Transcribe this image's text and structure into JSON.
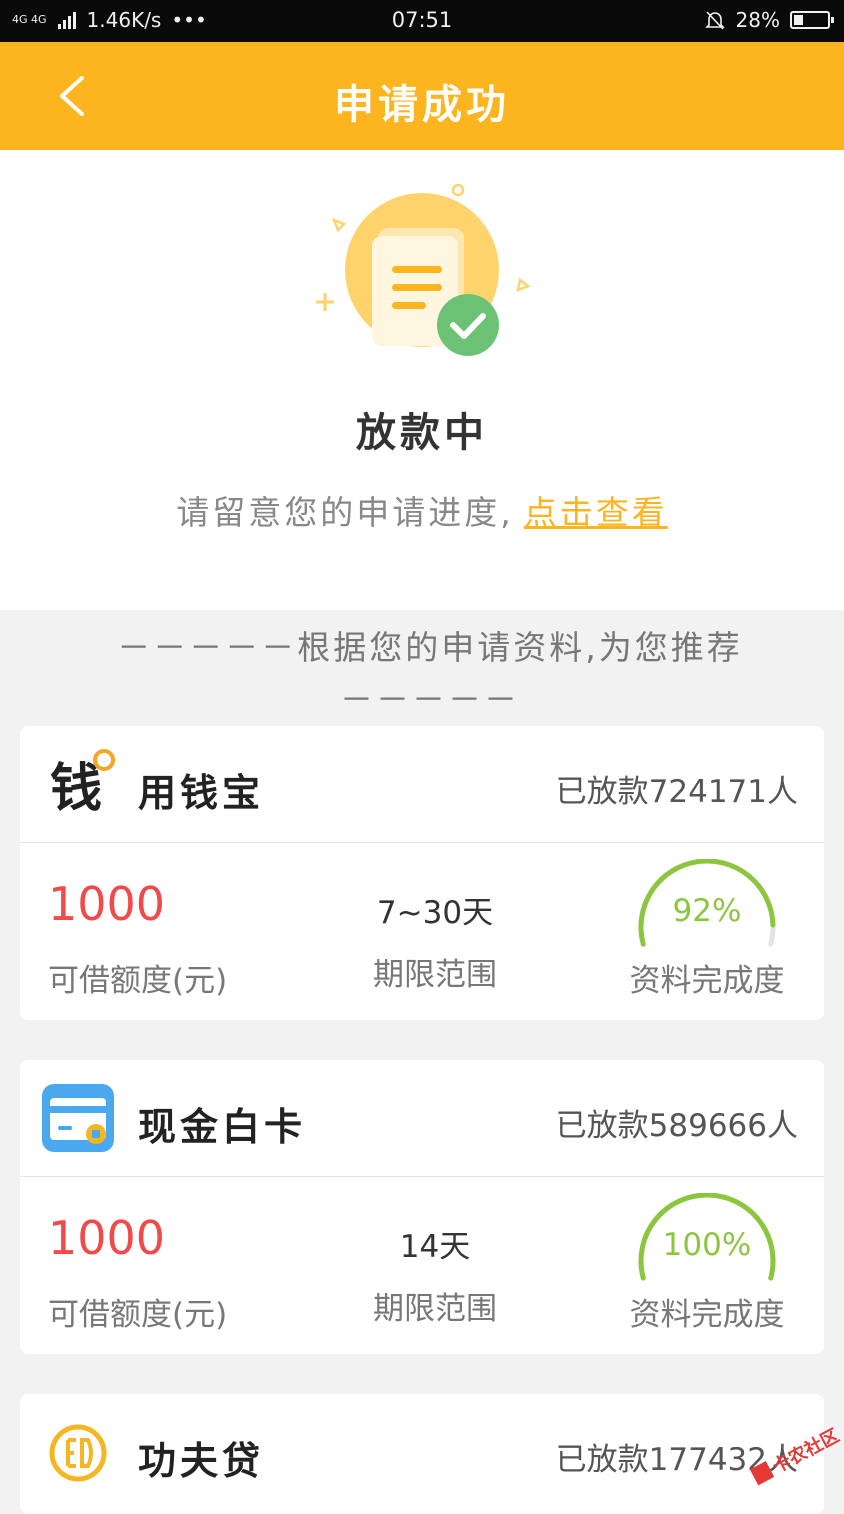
{
  "status_bar": {
    "network": "4G 4G",
    "speed": "1.46K/s",
    "dots": "•••",
    "time": "07:51",
    "battery": "28%",
    "battery_level": 0.28
  },
  "header": {
    "title": "申请成功"
  },
  "success": {
    "status_title": "放款中",
    "description": "请留意您的申请进度,",
    "link_text": "点击查看"
  },
  "recommend": {
    "heading_line1": "－－－－－根据您的申请资料,为您推荐",
    "heading_line2": "－－－－－"
  },
  "products": [
    {
      "name": "用钱宝",
      "logo_text": "钱",
      "count": "已放款724171人",
      "amount": "1000",
      "amount_label": "可借额度(元)",
      "term": "7~30天",
      "term_label": "期限范围",
      "completion": "92%",
      "completion_value": 0.92,
      "completion_label": "资料完成度"
    },
    {
      "name": "现金白卡",
      "count": "已放款589666人",
      "amount": "1000",
      "amount_label": "可借额度(元)",
      "term": "14天",
      "term_label": "期限范围",
      "completion": "100%",
      "completion_value": 1.0,
      "completion_label": "资料完成度"
    },
    {
      "name": "功夫贷",
      "count": "已放款177432人"
    }
  ],
  "watermark": {
    "text": "卡农社区"
  },
  "colors": {
    "brand": "#fdb51f",
    "amount": "#f04a4a",
    "gauge": "#8cc63f"
  }
}
